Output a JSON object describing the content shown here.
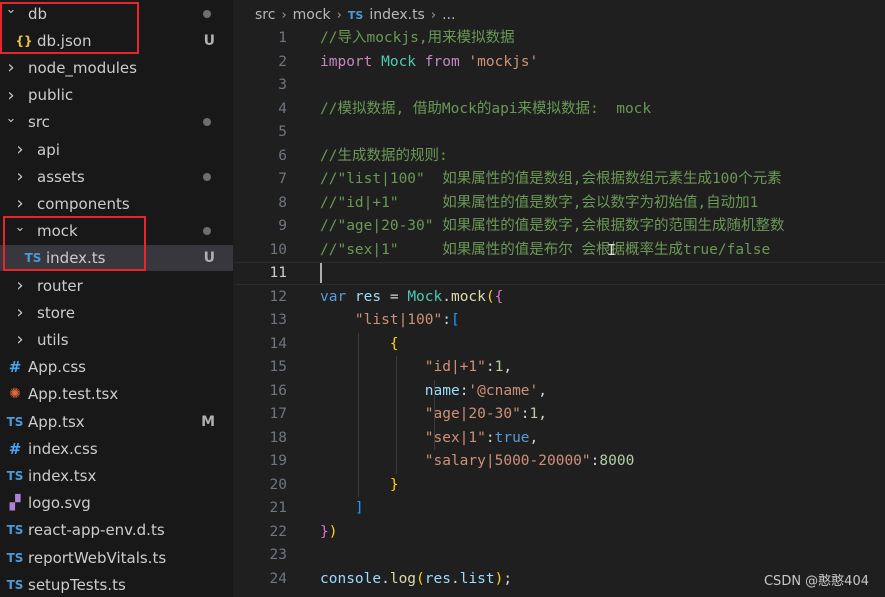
{
  "explorer": {
    "items": [
      {
        "name": "db",
        "type": "folder",
        "open": true,
        "indent": 0,
        "status": "dot"
      },
      {
        "name": "db.json",
        "type": "json",
        "indent": 1,
        "status": "U"
      },
      {
        "name": "node_modules",
        "type": "folder",
        "open": false,
        "indent": 0,
        "status": ""
      },
      {
        "name": "public",
        "type": "folder",
        "open": false,
        "indent": 0,
        "status": ""
      },
      {
        "name": "src",
        "type": "folder",
        "open": true,
        "indent": 0,
        "status": "dot"
      },
      {
        "name": "api",
        "type": "folder",
        "open": false,
        "indent": 1,
        "status": ""
      },
      {
        "name": "assets",
        "type": "folder",
        "open": false,
        "indent": 1,
        "status": "dot"
      },
      {
        "name": "components",
        "type": "folder",
        "open": false,
        "indent": 1,
        "status": ""
      },
      {
        "name": "mock",
        "type": "folder",
        "open": true,
        "indent": 1,
        "status": "dot"
      },
      {
        "name": "index.ts",
        "type": "ts",
        "indent": 2,
        "status": "U",
        "selected": true
      },
      {
        "name": "router",
        "type": "folder",
        "open": false,
        "indent": 1,
        "status": ""
      },
      {
        "name": "store",
        "type": "folder",
        "open": false,
        "indent": 1,
        "status": ""
      },
      {
        "name": "utils",
        "type": "folder",
        "open": false,
        "indent": 1,
        "status": ""
      },
      {
        "name": "App.css",
        "type": "css",
        "indent": 0,
        "status": ""
      },
      {
        "name": "App.test.tsx",
        "type": "react",
        "indent": 0,
        "status": ""
      },
      {
        "name": "App.tsx",
        "type": "ts",
        "indent": 0,
        "status": "M"
      },
      {
        "name": "index.css",
        "type": "css",
        "indent": 0,
        "status": ""
      },
      {
        "name": "index.tsx",
        "type": "ts",
        "indent": 0,
        "status": ""
      },
      {
        "name": "logo.svg",
        "type": "svg",
        "indent": 0,
        "status": ""
      },
      {
        "name": "react-app-env.d.ts",
        "type": "ts",
        "indent": 0,
        "status": ""
      },
      {
        "name": "reportWebVitals.ts",
        "type": "ts",
        "indent": 0,
        "status": ""
      },
      {
        "name": "setupTests.ts",
        "type": "ts",
        "indent": 0,
        "status": ""
      }
    ]
  },
  "icons": {
    "folder_closed": "chevron-right-icon",
    "folder_open": "chevron-down-icon",
    "ts": "typescript-icon",
    "json": "json-icon",
    "css": "css-hash-icon",
    "react": "react-test-icon",
    "svg": "svg-file-icon"
  },
  "icon_glyphs": {
    "ts": "TS",
    "json": "{}",
    "css": "#",
    "react": "✺",
    "svg": "▞"
  },
  "breadcrumb": {
    "parts": [
      "src",
      "mock",
      "index.ts",
      "..."
    ],
    "ts_badge": "TS"
  },
  "editor": {
    "active_line": 11,
    "lines": [
      [
        [
          "c-com",
          "//导入mockjs,用来模拟数据"
        ]
      ],
      [
        [
          "c-kw2",
          "import "
        ],
        [
          "c-cls",
          "Mock "
        ],
        [
          "c-kw2",
          "from "
        ],
        [
          "c-str",
          "'mockjs'"
        ]
      ],
      [],
      [
        [
          "c-com",
          "//模拟数据, 借助Mock的api来模拟数据:  mock"
        ]
      ],
      [],
      [
        [
          "c-com",
          "//生成数据的规则:"
        ]
      ],
      [
        [
          "c-com",
          "//\"list|100\"  如果属性的值是数组,会根据数组元素生成100个元素"
        ]
      ],
      [
        [
          "c-com",
          "//\"id|+1\"     如果属性的值是数字,会以数字为初始值,自动加1"
        ]
      ],
      [
        [
          "c-com",
          "//\"age|20-30\" 如果属性的值是数字,会根据数字的范围生成随机整数"
        ]
      ],
      [
        [
          "c-com",
          "//\"sex|1\"     如果属性的值是布尔 会根据概率生成true/false"
        ]
      ],
      [],
      [
        [
          "c-kw",
          "var "
        ],
        [
          "c-var",
          "res "
        ],
        [
          "c-pun",
          "= "
        ],
        [
          "c-cls",
          "Mock"
        ],
        [
          "c-pun",
          "."
        ],
        [
          "c-fn",
          "mock"
        ],
        [
          "c-br2",
          "("
        ],
        [
          "c-br1",
          "{"
        ]
      ],
      [
        [
          "c-pun",
          "    "
        ],
        [
          "c-str",
          "\"list|100\""
        ],
        [
          "c-pun",
          ":"
        ],
        [
          "c-br3",
          "["
        ]
      ],
      [
        [
          "c-pun",
          "        "
        ],
        [
          "c-br2",
          "{"
        ]
      ],
      [
        [
          "c-pun",
          "            "
        ],
        [
          "c-str",
          "\"id|+1\""
        ],
        [
          "c-pun",
          ":"
        ],
        [
          "c-num",
          "1"
        ],
        [
          "c-pun",
          ","
        ]
      ],
      [
        [
          "c-pun",
          "            "
        ],
        [
          "c-var",
          "name"
        ],
        [
          "c-pun",
          ":"
        ],
        [
          "c-str",
          "'@cname'"
        ],
        [
          "c-pun",
          ","
        ]
      ],
      [
        [
          "c-pun",
          "            "
        ],
        [
          "c-str",
          "\"age|20-30\""
        ],
        [
          "c-pun",
          ":"
        ],
        [
          "c-num",
          "1"
        ],
        [
          "c-pun",
          ","
        ]
      ],
      [
        [
          "c-pun",
          "            "
        ],
        [
          "c-str",
          "\"sex|1\""
        ],
        [
          "c-pun",
          ":"
        ],
        [
          "c-kw",
          "true"
        ],
        [
          "c-pun",
          ","
        ]
      ],
      [
        [
          "c-pun",
          "            "
        ],
        [
          "c-str",
          "\"salary|5000-20000\""
        ],
        [
          "c-pun",
          ":"
        ],
        [
          "c-num",
          "8000"
        ]
      ],
      [
        [
          "c-pun",
          "        "
        ],
        [
          "c-br2",
          "}"
        ]
      ],
      [
        [
          "c-pun",
          "    "
        ],
        [
          "c-br3",
          "]"
        ]
      ],
      [
        [
          "c-br1",
          "}"
        ],
        [
          "c-br2",
          ")"
        ]
      ],
      [],
      [
        [
          "c-var",
          "console"
        ],
        [
          "c-pun",
          "."
        ],
        [
          "c-fn",
          "log"
        ],
        [
          "c-br2",
          "("
        ],
        [
          "c-var",
          "res"
        ],
        [
          "c-pun",
          "."
        ],
        [
          "c-var",
          "list"
        ],
        [
          "c-br2",
          ")"
        ],
        [
          "c-pun",
          ";"
        ]
      ]
    ]
  },
  "cursor_glyph": "I",
  "watermark": "CSDN @憨憨404",
  "colors": {
    "annotation_box": "#e8252b",
    "selection": "#37373d",
    "background": "#1f1f1f"
  }
}
